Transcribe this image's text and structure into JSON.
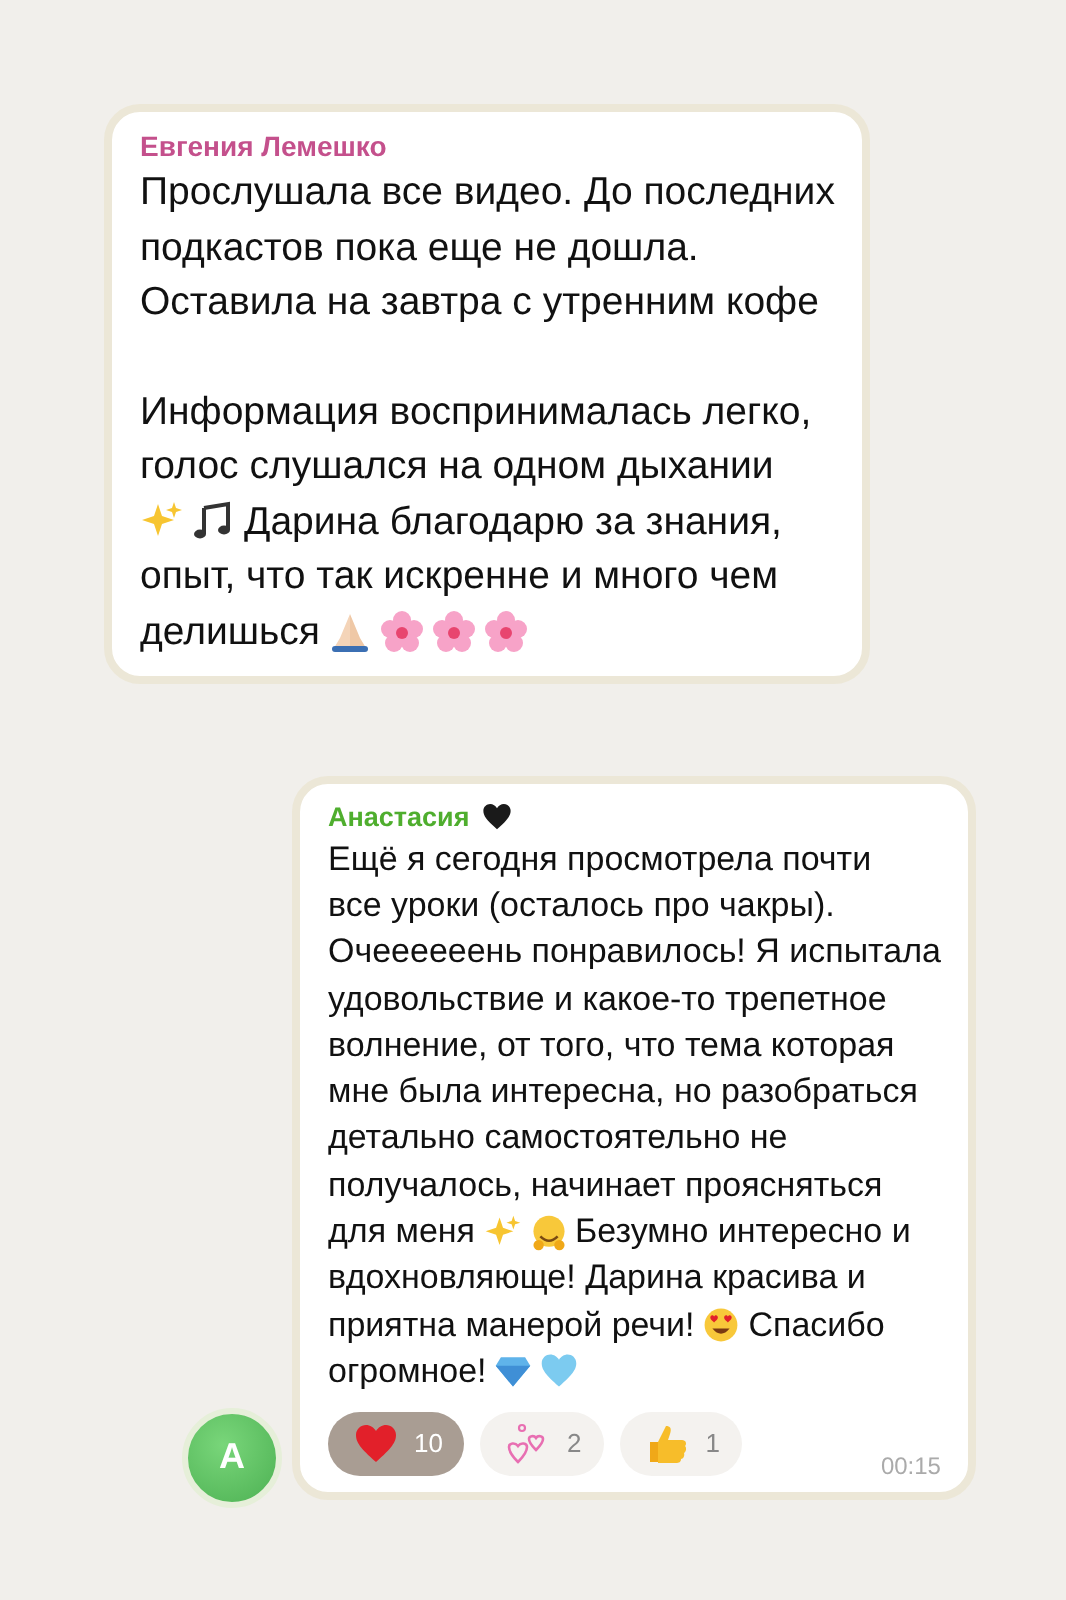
{
  "messages": [
    {
      "sender": "Евгения Лемешко",
      "color": "#c4508c",
      "paragraphs": [
        [
          [
            {
              "kind": "text",
              "text": "Прослушала все видео. До последних"
            }
          ],
          [
            {
              "kind": "text",
              "text": "подкастов пока еще не дошла."
            }
          ],
          [
            {
              "kind": "text",
              "text": "Оставила на завтра с утренним кофе"
            }
          ]
        ],
        [
          [
            {
              "kind": "text",
              "text": "Информация воспринималась легко,"
            }
          ],
          [
            {
              "kind": "text",
              "text": "голос слушался на одном дыхании"
            }
          ],
          [
            {
              "kind": "sparkles"
            },
            {
              "kind": "notes"
            },
            {
              "kind": "text",
              "text": "Дарина благодарю за знания,"
            }
          ],
          [
            {
              "kind": "text",
              "text": "опыт, что так искренне и много чем"
            }
          ],
          [
            {
              "kind": "text",
              "text": "делишься"
            },
            {
              "kind": "pray"
            },
            {
              "kind": "blossom"
            },
            {
              "kind": "blossom"
            },
            {
              "kind": "blossom"
            }
          ]
        ]
      ]
    },
    {
      "sender": "Анастасия",
      "color": "#4fae2e",
      "avatar": "A",
      "time": "00:15",
      "paragraphs": [
        [
          [
            {
              "kind": "text",
              "text": "Ещё я сегодня просмотрела почти"
            }
          ],
          [
            {
              "kind": "text",
              "text": "все уроки (осталось про чакры)."
            }
          ],
          [
            {
              "kind": "text",
              "text": "Очеееееень понравилось! Я испытала"
            }
          ],
          [
            {
              "kind": "text",
              "text": "удовольствие и какое-то трепетное"
            }
          ],
          [
            {
              "kind": "text",
              "text": "волнение, от того, что тема которая"
            }
          ],
          [
            {
              "kind": "text",
              "text": "мне была интересна, но разобраться"
            }
          ],
          [
            {
              "kind": "text",
              "text": "детально самостоятельно не"
            }
          ],
          [
            {
              "kind": "text",
              "text": "получалось, начинает проясняться"
            }
          ],
          [
            {
              "kind": "text",
              "text": "для меня"
            },
            {
              "kind": "sparkles"
            },
            {
              "kind": "hug"
            },
            {
              "kind": "text",
              "text": "Безумно интересно и"
            }
          ],
          [
            {
              "kind": "text",
              "text": "вдохновляюще! Дарина красива и"
            }
          ],
          [
            {
              "kind": "text",
              "text": "приятна манерой речи!"
            },
            {
              "kind": "hearteyes"
            },
            {
              "kind": "text",
              "text": "Спасибо"
            }
          ],
          [
            {
              "kind": "text",
              "text": "огромное!"
            },
            {
              "kind": "gem"
            },
            {
              "kind": "blueheart"
            }
          ]
        ]
      ],
      "reactions": [
        {
          "count": "10",
          "selected": true
        },
        {
          "count": "2",
          "selected": false
        },
        {
          "count": "1",
          "selected": false
        }
      ]
    }
  ]
}
